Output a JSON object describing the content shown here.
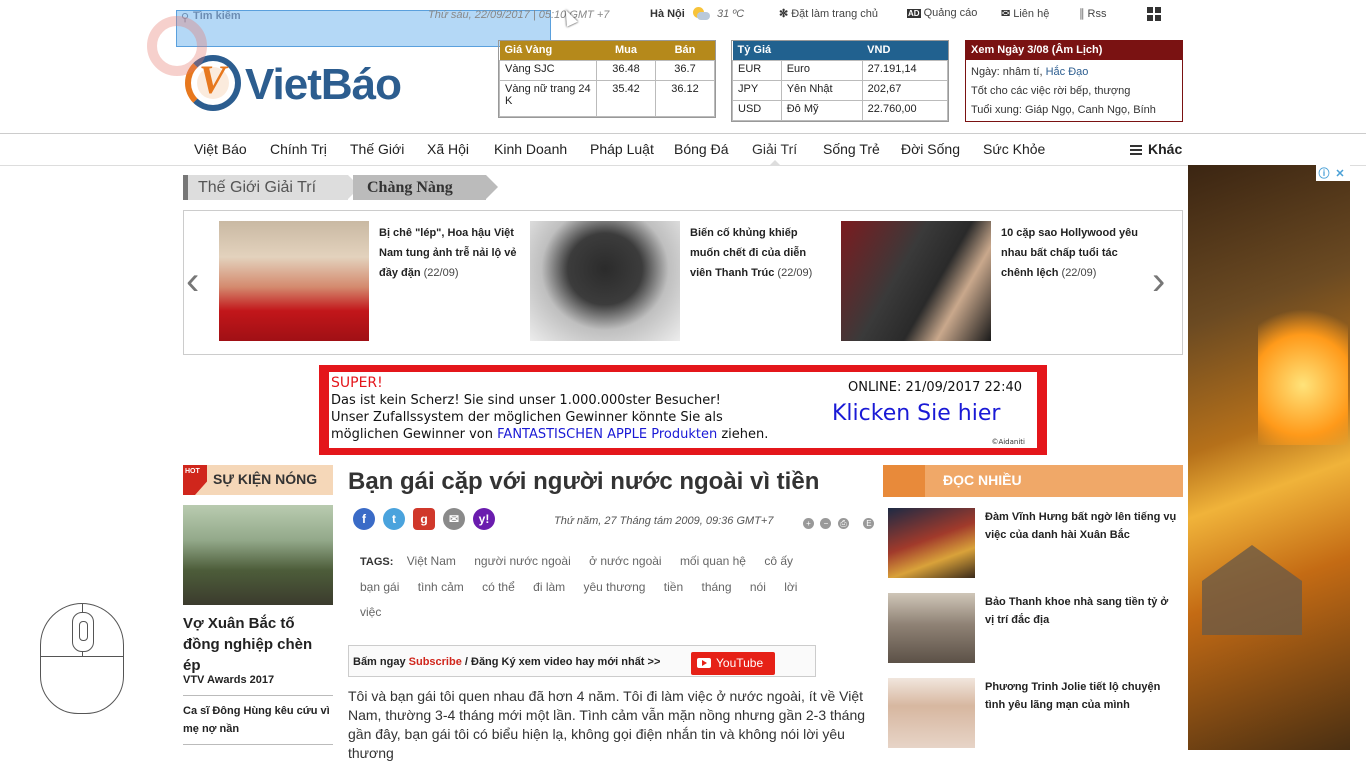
{
  "topbar": {
    "search_placeholder": "Tìm kiếm",
    "datetime": "Thứ sáu, 22/09/2017 | 05:10 GMT +7",
    "city": "Hà Nội",
    "temperature": "31 ºC",
    "links": [
      {
        "icon": "homepage-icon",
        "label": "Đặt làm trang chủ"
      },
      {
        "icon": "ad-icon",
        "label": "Quảng cáo"
      },
      {
        "icon": "mail-icon",
        "label": "Liên hệ"
      },
      {
        "icon": "rss-icon",
        "label": "Rss"
      }
    ]
  },
  "logo": {
    "text": "VietBáo",
    "accent": "#e7781e",
    "brand": "#2c5d8f"
  },
  "gold": {
    "headers": [
      "Giá Vàng",
      "Mua",
      "Bán"
    ],
    "rows": [
      {
        "name": "Vàng SJC",
        "buy": "36.48",
        "sell": "36.7"
      },
      {
        "name": "Vàng nữ trang 24 K",
        "buy": "35.42",
        "sell": "36.12"
      }
    ]
  },
  "fx": {
    "headers": [
      "Tỷ Giá",
      "VND"
    ],
    "rows": [
      {
        "code": "EUR",
        "name": "Euro",
        "rate": "27.191,14"
      },
      {
        "code": "JPY",
        "name": "Yên Nhật",
        "rate": "202,67"
      },
      {
        "code": "USD",
        "name": "Đô Mỹ",
        "rate": "22.760,00"
      }
    ]
  },
  "lunar": {
    "title": "Xem Ngày 3/08 (Âm Lịch)",
    "day_prefix": "Ngày: nhâm tí, ",
    "day_link": "Hắc Đạo",
    "good": "Tốt cho các việc rời bếp, thượng",
    "conflict": "Tuổi xung: Giáp Ngọ, Canh Ngọ, Bính"
  },
  "nav": {
    "items": [
      "Việt Báo",
      "Chính Trị",
      "Thế Giới",
      "Xã Hội",
      "Kinh Doanh",
      "Pháp Luật",
      "Bóng Đá",
      "Giải Trí",
      "Sống Trẻ",
      "Đời Sống",
      "Sức Khỏe"
    ],
    "more": "Khác"
  },
  "breadcrumb": {
    "parent": "Thế Giới Giải Trí",
    "current": "Chàng Nàng"
  },
  "carousel": [
    {
      "title": "Bị chê \"lép\", Hoa hậu Việt Nam tung ảnh trễ nải lộ vẻ đầy đặn",
      "date": " (22/09)"
    },
    {
      "title": "Biến cố khủng khiếp muốn chết đi của diễn viên Thanh Trúc",
      "date": " (22/09)"
    },
    {
      "title": "10 cặp sao Hollywood yêu nhau bất chấp tuổi tác chênh lệch",
      "date": " (22/09)"
    }
  ],
  "ad_banner": {
    "super": "SUPER!",
    "line1": "Das ist kein Scherz! Sie sind unser 1.000.000ster Besucher!",
    "line2": "Unser Zufallssystem der möglichen Gewinner könnte Sie als",
    "line3_prefix": "möglichen Gewinner von ",
    "line3_link": "FANTASTISCHEN APPLE Produkten",
    "line3_suffix": " ziehen.",
    "online": "ONLINE: 21/09/2017 22:40",
    "cta": "Klicken Sie hier",
    "copyright": "©Aidaniti"
  },
  "hot": {
    "badge": "HOT",
    "heading": "SỰ KIỆN NÓNG",
    "main_title": "Vợ Xuân Bắc tố đồng nghiệp chèn ép",
    "items": [
      "VTV Awards 2017",
      "Ca sĩ Đông Hùng kêu cứu vì mẹ nợ nần"
    ]
  },
  "article": {
    "title": "Bạn gái cặp với người nước ngoài vì tiền",
    "date": "Thứ năm, 27 Tháng tám 2009, 09:36 GMT+7",
    "tags_label": "TAGS:",
    "tags": [
      "Việt Nam",
      "người nước ngoài",
      "ở nước ngoài",
      "mối quan hệ",
      "cô ấy",
      "bạn gái",
      "tình cảm",
      "có thể",
      "đi làm",
      "yêu thương",
      "tiền",
      "tháng",
      "nói",
      "lời",
      "việc"
    ],
    "subscribe_prefix": "Bấm ngay ",
    "subscribe_red": "Subscribe",
    "subscribe_suffix": " / Đăng Ký xem video hay mới nhất >>",
    "youtube": "YouTube",
    "body": "Tôi và bạn gái tôi quen nhau đã hơn 4 năm. Tôi đi làm việc ở nước ngoài, ít về Việt Nam, thường 3-4 tháng mới một lần. Tình cảm vẫn mặn nồng nhưng gần 2-3 tháng gần đây, bạn gái tôi có biểu hiện lạ, không gọi điện nhắn tin và không nói lời yêu thương"
  },
  "most_read": {
    "heading": "ĐỌC NHIỀU",
    "items": [
      "Đàm Vĩnh Hưng bất ngờ lên tiếng vụ việc của danh hài Xuân Bắc",
      "Bảo Thanh khoe nhà sang tiền tỷ ở vị trí đắc địa",
      "Phương Trinh Jolie tiết lộ chuyện tình yêu lãng mạn của mình"
    ]
  }
}
